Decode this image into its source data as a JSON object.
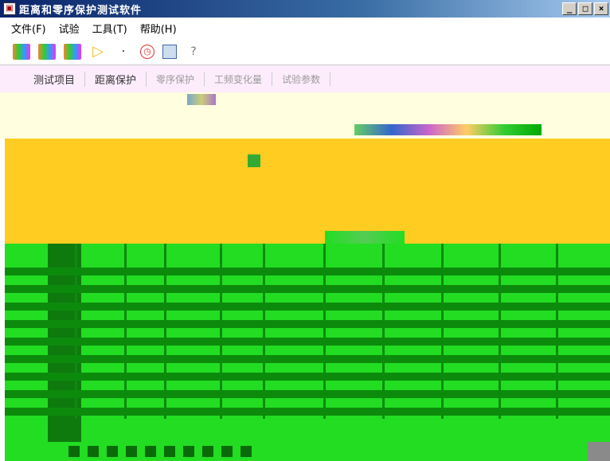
{
  "window": {
    "title": "距离和零序保护测试软件",
    "buttons": {
      "minimize": "_",
      "maximize": "□",
      "close": "×"
    }
  },
  "menu": {
    "items": [
      "文件(F)",
      "试验",
      "工具(T)",
      "帮助(H)"
    ]
  },
  "toolbar": {
    "icons": [
      "app-logo-icon",
      "color-chart-icon",
      "play-icon",
      "clock-icon",
      "document-icon",
      "help-icon"
    ]
  },
  "tabs": [
    {
      "label": "测试项目",
      "state": "active"
    },
    {
      "label": "距离保护",
      "state": "active"
    },
    {
      "label": "零序保护",
      "state": "inactive"
    },
    {
      "label": "工频变化量",
      "state": "inactive"
    },
    {
      "label": "试验参数",
      "state": "inactive"
    }
  ],
  "colors": {
    "titlebar_start": "#0a246a",
    "tab_background": "#fcecfc",
    "upper_panel": "#ffffe0",
    "orange_panel": "#ffcc22",
    "green_table": "#22dd22",
    "dark_green": "#0c8a0c"
  }
}
